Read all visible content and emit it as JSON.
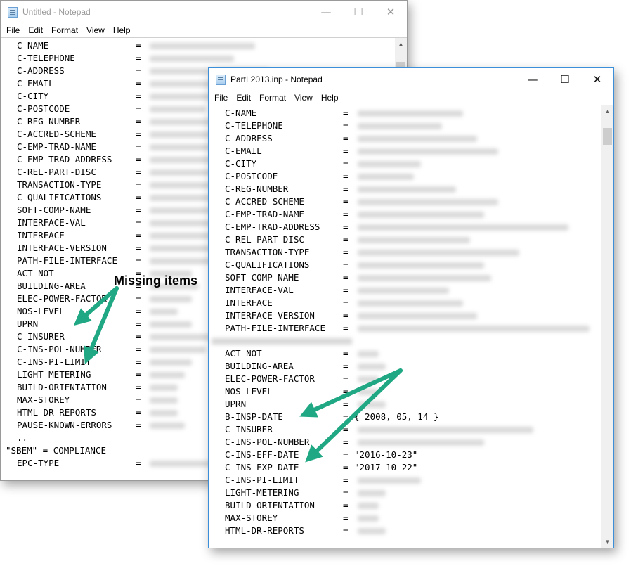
{
  "win1": {
    "title": "Untitled - Notepad",
    "menu": [
      "File",
      "Edit",
      "Format",
      "View",
      "Help"
    ],
    "lines": [
      {
        "key": "C-NAME",
        "eq": "="
      },
      {
        "key": "C-TELEPHONE",
        "eq": "="
      },
      {
        "key": "C-ADDRESS",
        "eq": "="
      },
      {
        "key": "C-EMAIL",
        "eq": "="
      },
      {
        "key": "C-CITY",
        "eq": "="
      },
      {
        "key": "C-POSTCODE",
        "eq": "="
      },
      {
        "key": "C-REG-NUMBER",
        "eq": "="
      },
      {
        "key": "C-ACCRED-SCHEME",
        "eq": "="
      },
      {
        "key": "C-EMP-TRAD-NAME",
        "eq": "="
      },
      {
        "key": "C-EMP-TRAD-ADDRESS",
        "eq": "="
      },
      {
        "key": "C-REL-PART-DISC",
        "eq": "="
      },
      {
        "key": "TRANSACTION-TYPE",
        "eq": "="
      },
      {
        "key": "C-QUALIFICATIONS",
        "eq": "="
      },
      {
        "key": "SOFT-COMP-NAME",
        "eq": "="
      },
      {
        "key": "INTERFACE-VAL",
        "eq": "="
      },
      {
        "key": "INTERFACE",
        "eq": "="
      },
      {
        "key": "INTERFACE-VERSION",
        "eq": "="
      },
      {
        "key": "PATH-FILE-INTERFACE",
        "eq": "="
      },
      {
        "key": "ACT-NOT",
        "eq": "="
      },
      {
        "key": "BUILDING-AREA",
        "eq": "="
      },
      {
        "key": "ELEC-POWER-FACTOR",
        "eq": "="
      },
      {
        "key": "NOS-LEVEL",
        "eq": "="
      },
      {
        "key": "UPRN",
        "eq": "="
      },
      {
        "key": "C-INSURER",
        "eq": "="
      },
      {
        "key": "C-INS-POL-NUMBER",
        "eq": "="
      },
      {
        "key": "C-INS-PI-LIMIT",
        "eq": "="
      },
      {
        "key": "LIGHT-METERING",
        "eq": "="
      },
      {
        "key": "BUILD-ORIENTATION",
        "eq": "="
      },
      {
        "key": "MAX-STOREY",
        "eq": "="
      },
      {
        "key": "HTML-DR-REPORTS",
        "eq": "="
      },
      {
        "key": "PAUSE-KNOWN-ERRORS",
        "eq": "="
      },
      {
        "key": "..",
        "eq": ""
      },
      {
        "key": "\"SBEM\" = COMPLIANCE",
        "eq": ""
      },
      {
        "key": "EPC-TYPE",
        "eq": "="
      }
    ]
  },
  "win2": {
    "title": "PartL2013.inp - Notepad",
    "menu": [
      "File",
      "Edit",
      "Format",
      "View",
      "Help"
    ],
    "lines": [
      {
        "key": "C-NAME",
        "eq": "=",
        "val": ""
      },
      {
        "key": "C-TELEPHONE",
        "eq": "=",
        "val": ""
      },
      {
        "key": "C-ADDRESS",
        "eq": "=",
        "val": ""
      },
      {
        "key": "C-EMAIL",
        "eq": "=",
        "val": ""
      },
      {
        "key": "C-CITY",
        "eq": "=",
        "val": ""
      },
      {
        "key": "C-POSTCODE",
        "eq": "=",
        "val": ""
      },
      {
        "key": "C-REG-NUMBER",
        "eq": "=",
        "val": ""
      },
      {
        "key": "C-ACCRED-SCHEME",
        "eq": "=",
        "val": ""
      },
      {
        "key": "C-EMP-TRAD-NAME",
        "eq": "=",
        "val": ""
      },
      {
        "key": "C-EMP-TRAD-ADDRESS",
        "eq": "=",
        "val": ""
      },
      {
        "key": "C-REL-PART-DISC",
        "eq": "=",
        "val": ""
      },
      {
        "key": "TRANSACTION-TYPE",
        "eq": "=",
        "val": ""
      },
      {
        "key": "C-QUALIFICATIONS",
        "eq": "=",
        "val": ""
      },
      {
        "key": "SOFT-COMP-NAME",
        "eq": "=",
        "val": ""
      },
      {
        "key": "INTERFACE-VAL",
        "eq": "=",
        "val": ""
      },
      {
        "key": "INTERFACE",
        "eq": "=",
        "val": ""
      },
      {
        "key": "INTERFACE-VERSION",
        "eq": "=",
        "val": ""
      },
      {
        "key": "PATH-FILE-INTERFACE",
        "eq": "=",
        "val": ""
      },
      {
        "key": "",
        "eq": "",
        "val": ""
      },
      {
        "key": "ACT-NOT",
        "eq": "=",
        "val": ""
      },
      {
        "key": "BUILDING-AREA",
        "eq": "=",
        "val": ""
      },
      {
        "key": "ELEC-POWER-FACTOR",
        "eq": "=",
        "val": ""
      },
      {
        "key": "NOS-LEVEL",
        "eq": "=",
        "val": ""
      },
      {
        "key": "UPRN",
        "eq": "=",
        "val": ""
      },
      {
        "key": "B-INSP-DATE",
        "eq": "=",
        "val": "{ 2008, 05, 14 }"
      },
      {
        "key": "C-INSURER",
        "eq": "=",
        "val": ""
      },
      {
        "key": "C-INS-POL-NUMBER",
        "eq": "=",
        "val": ""
      },
      {
        "key": "C-INS-EFF-DATE",
        "eq": "=",
        "val": "\"2016-10-23\""
      },
      {
        "key": "C-INS-EXP-DATE",
        "eq": "=",
        "val": "\"2017-10-22\""
      },
      {
        "key": "C-INS-PI-LIMIT",
        "eq": "=",
        "val": ""
      },
      {
        "key": "LIGHT-METERING",
        "eq": "=",
        "val": ""
      },
      {
        "key": "BUILD-ORIENTATION",
        "eq": "=",
        "val": ""
      },
      {
        "key": "MAX-STOREY",
        "eq": "=",
        "val": ""
      },
      {
        "key": "HTML-DR-REPORTS",
        "eq": "=",
        "val": ""
      }
    ]
  },
  "annotation": {
    "text": "Missing items",
    "arrow_color": "#1fa883"
  },
  "controls": {
    "minimize": "—",
    "maximize": "☐",
    "close": "✕",
    "scroll_up": "▲",
    "scroll_down": "▼"
  }
}
